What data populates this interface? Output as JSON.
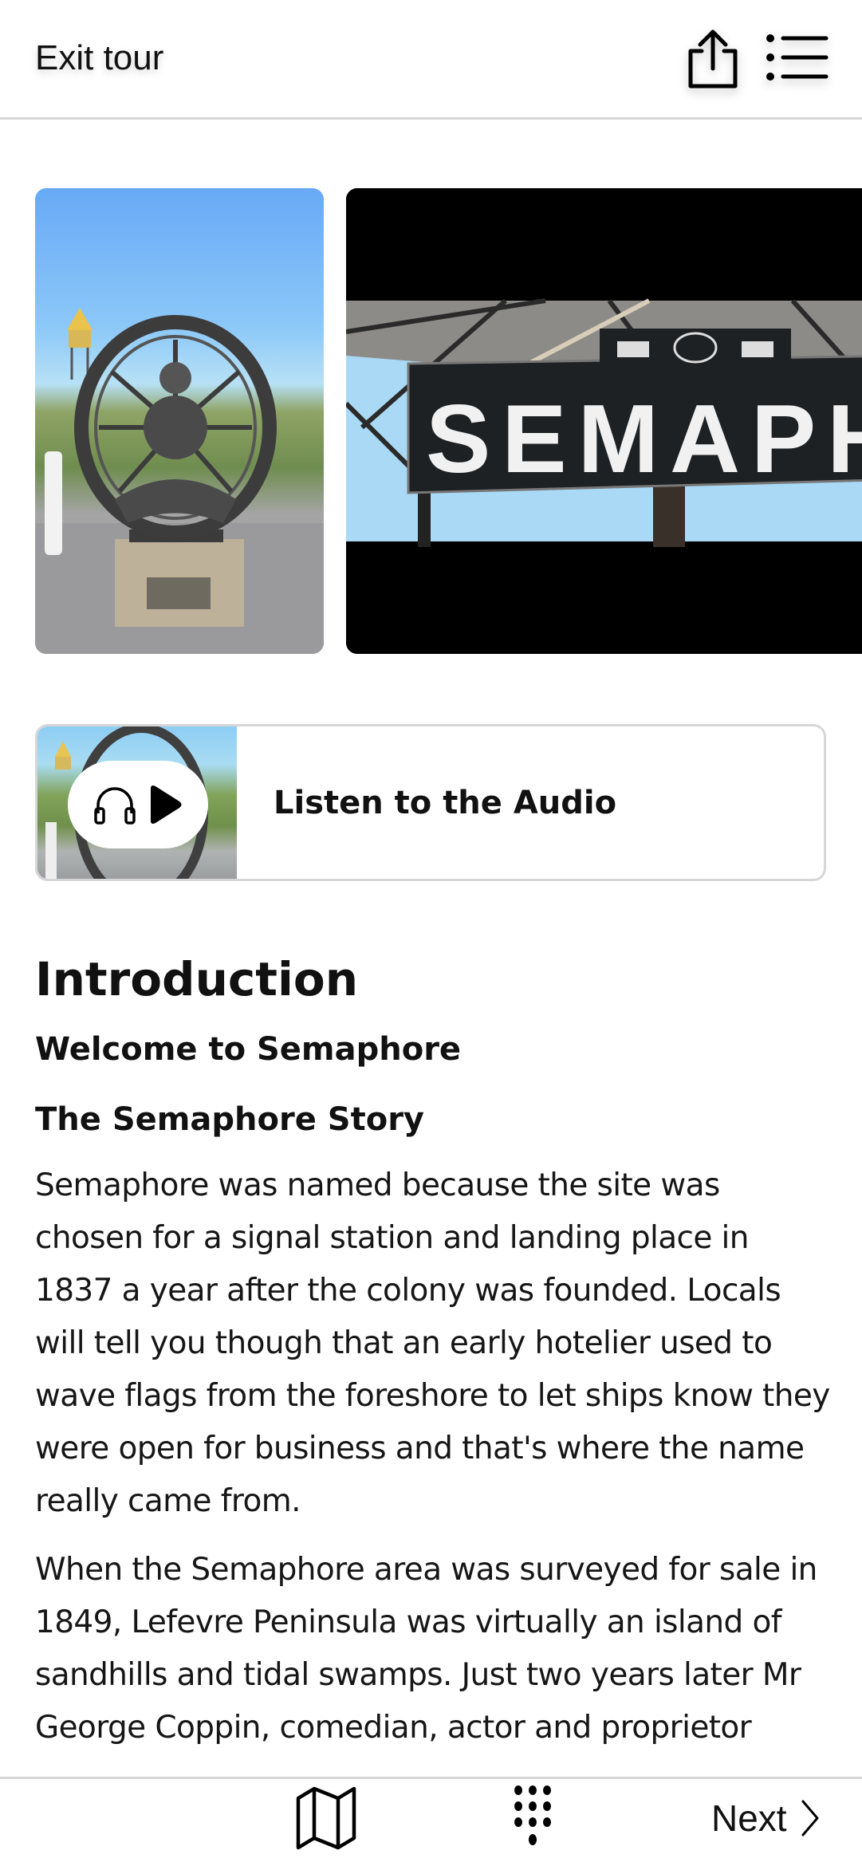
{
  "header": {
    "exit_label": "Exit tour",
    "icons": [
      "share-icon",
      "list-icon"
    ]
  },
  "carousel": {
    "images": [
      {
        "alt": "Locomotive wheel monument at Semaphore foreshore"
      },
      {
        "alt": "Semaphore station sign",
        "sign_text": "SEMAPHO"
      }
    ]
  },
  "audio": {
    "label": "Listen to the Audio",
    "icons": [
      "headphones-icon",
      "play-icon"
    ]
  },
  "article": {
    "title": "Introduction",
    "subtitle": "Welcome to Semaphore",
    "section_title": "The Semaphore Story",
    "paragraphs": [
      "Semaphore was named because the site was chosen for a signal station and landing place in 1837 a year after the colony was founded. Locals will tell you though that an early hotelier used to wave flags from the foreshore to let ships know they were open for business and that's where the name really came from.",
      "When the Semaphore area was surveyed for sale in 1849, Lefevre Peninsula was virtually an island of sandhills and tidal swamps. Just two years later Mr George Coppin, comedian, actor and proprietor"
    ]
  },
  "bottom_nav": {
    "icons": [
      "map-icon",
      "keypad-icon"
    ],
    "next_label": "Next"
  }
}
